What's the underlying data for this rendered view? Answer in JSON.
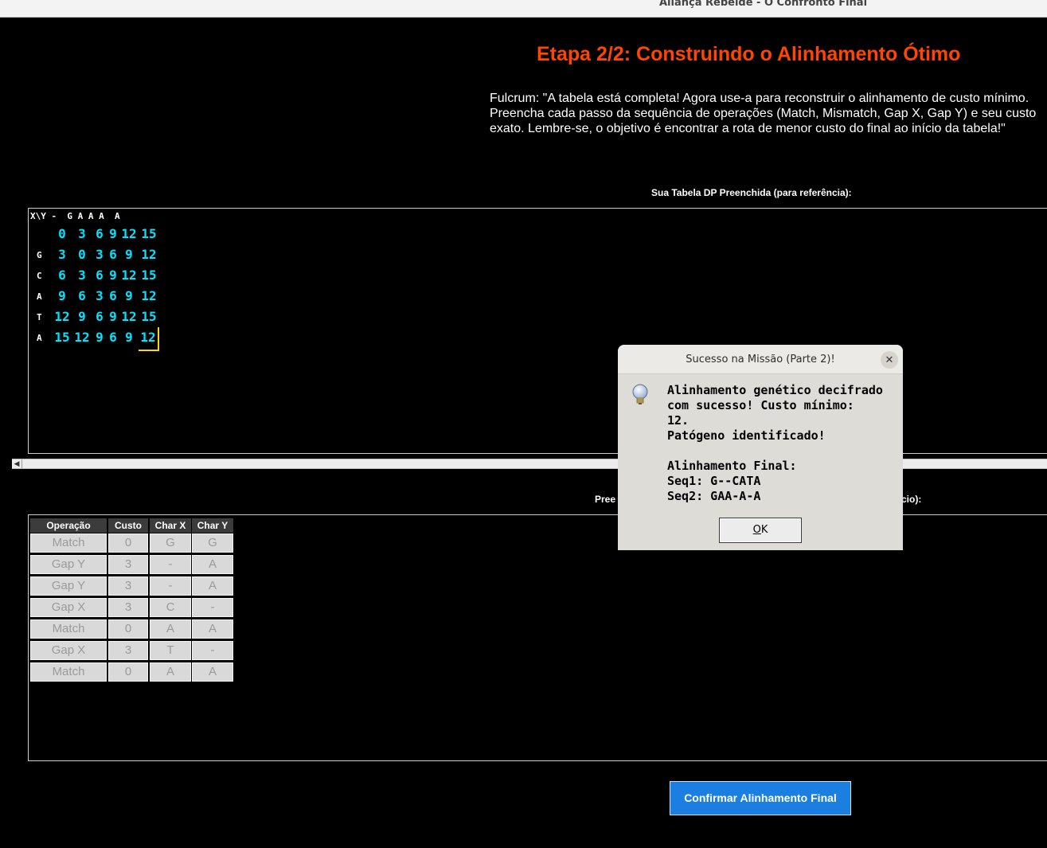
{
  "window": {
    "title": "Aliança Rebelde - O Confronto Final"
  },
  "heading": "Etapa 2/2: Construindo o Alinhamento Ótimo",
  "intro": "Fulcrum: \"A tabela está completa! Agora use-a para reconstruir o alinhamento de custo mínimo. Preencha cada passo da sequência de operações (Match, Mismatch, Gap X, Gap Y) e seu custo exato. Lembre-se, o objetivo é encontrar a rota de menor custo do final ao início da tabela!\"",
  "dp_section_label": "Sua Tabela DP Preenchida (para referência):",
  "ops_section_label_left": "Pree",
  "ops_section_label_right": "cio):",
  "dp_table": {
    "header": "X\\Y -  G A A A  A",
    "rows": [
      {
        "label": "",
        "values": [
          "0",
          "3",
          "6",
          "9",
          "12",
          "15"
        ]
      },
      {
        "label": "G",
        "values": [
          "3",
          "0",
          "3",
          "6",
          "9",
          "12"
        ]
      },
      {
        "label": "C",
        "values": [
          "6",
          "3",
          "6",
          "9",
          "12",
          "15"
        ]
      },
      {
        "label": "A",
        "values": [
          "9",
          "6",
          "3",
          "6",
          "9",
          "12"
        ]
      },
      {
        "label": "T",
        "values": [
          "12",
          "9",
          "6",
          "9",
          "12",
          "15"
        ]
      },
      {
        "label": "A",
        "values": [
          "15",
          "12",
          "9",
          "6",
          "9",
          "12"
        ]
      }
    ],
    "selected_color": "#ffd700",
    "value_color": "#00e5ff"
  },
  "ops_table": {
    "headers": [
      "Operação",
      "Custo",
      "Char X",
      "Char Y"
    ],
    "rows": [
      [
        "Match",
        "0",
        "G",
        "G"
      ],
      [
        "Gap Y",
        "3",
        "-",
        "A"
      ],
      [
        "Gap Y",
        "3",
        "-",
        "A"
      ],
      [
        "Gap X",
        "3",
        "C",
        "-"
      ],
      [
        "Match",
        "0",
        "A",
        "A"
      ],
      [
        "Gap X",
        "3",
        "T",
        "-"
      ],
      [
        "Match",
        "0",
        "A",
        "A"
      ]
    ]
  },
  "confirm_button": "Confirmar Alinhamento Final",
  "dialog": {
    "title": "Sucesso na Missão (Parte 2)!",
    "close_glyph": "✕",
    "icon": "lightbulb-icon",
    "lines": [
      "Alinhamento genético decifrado",
      "com sucesso! Custo mínimo:",
      "12.",
      "Patógeno identificado!",
      "",
      "Alinhamento Final:",
      "Seq1: G--CATA",
      "Seq2: GAA-A-A"
    ],
    "ok_first": "O",
    "ok_rest": "K"
  },
  "colors": {
    "accent": "#ff4500",
    "button": "#1a7fe0",
    "cyan": "#00e5ff"
  }
}
